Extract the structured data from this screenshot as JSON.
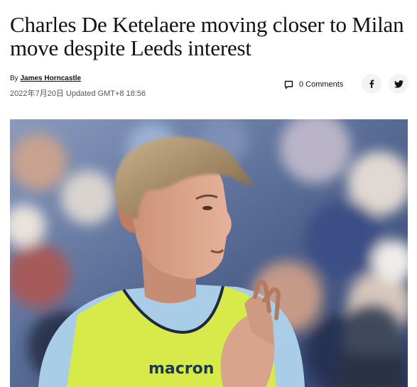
{
  "article": {
    "headline": "Charles De Ketelaere moving closer to Milan move despite Leeds interest",
    "byline_prefix": "By",
    "author": "James Horncastle",
    "timestamp": "2022年7月20日 Updated GMT+8 18:56",
    "comments_label": "0 Comments"
  },
  "share": {
    "facebook_icon": "facebook-icon",
    "twitter_icon": "twitter-icon"
  },
  "hero_image": {
    "bib_text": "macron"
  },
  "colors": {
    "text": "#121212",
    "muted": "#555555",
    "bib": "#d7ea4a",
    "shirt": "#a9cde6"
  }
}
